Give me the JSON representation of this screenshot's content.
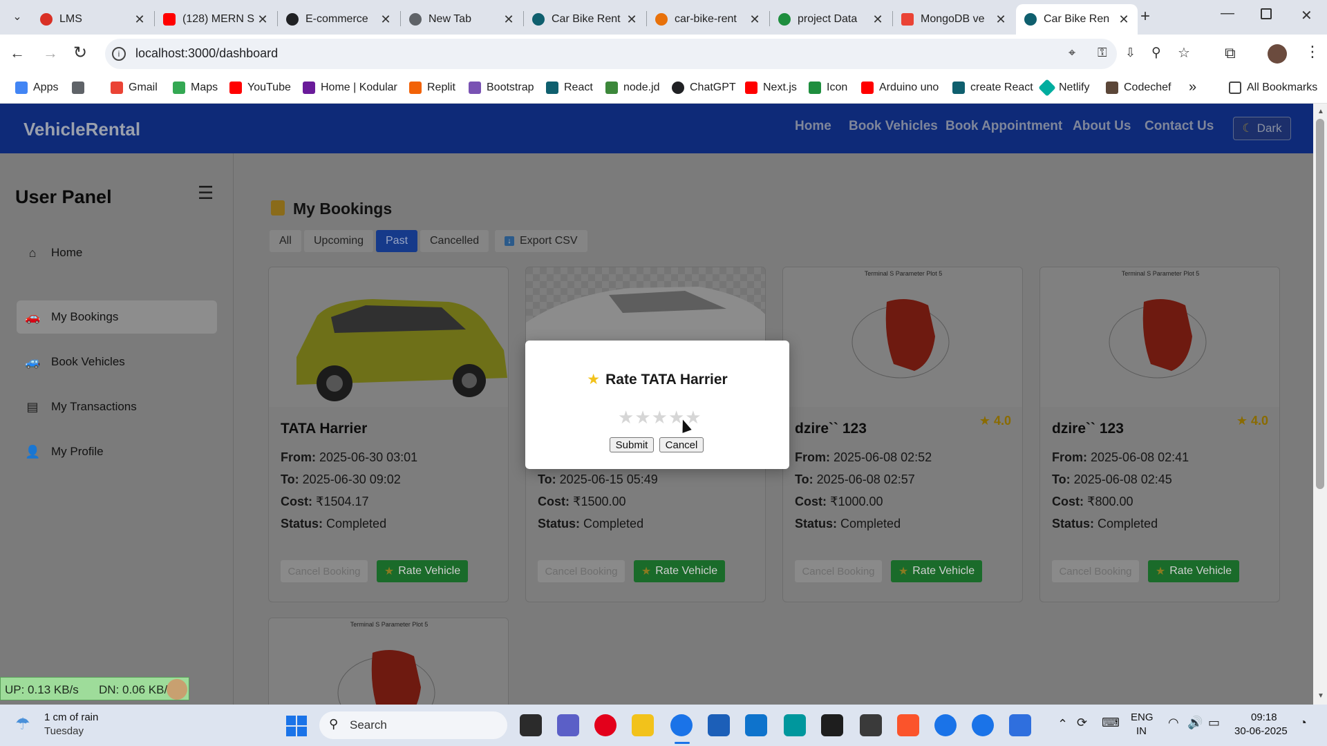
{
  "browser": {
    "tabs": [
      {
        "title": "LMS",
        "favicon_color": "#d93025"
      },
      {
        "title": "(128) MERN S",
        "favicon_color": "#ff0000"
      },
      {
        "title": "E-commerce",
        "favicon_color": "#202124"
      },
      {
        "title": "New Tab",
        "favicon_color": "#5f6368"
      },
      {
        "title": "Car Bike Rent",
        "favicon_color": "#0f5f6e"
      },
      {
        "title": "car-bike-rent",
        "favicon_color": "#e8710a"
      },
      {
        "title": "project Data",
        "favicon_color": "#1e8e3e"
      },
      {
        "title": "MongoDB ve",
        "favicon_color": "#ea4335"
      },
      {
        "title": "Car Bike Ren",
        "favicon_color": "#0f5f6e"
      }
    ],
    "url": "localhost:3000/dashboard",
    "bookmarks": [
      {
        "label": "Apps",
        "color": "#4285f4"
      },
      {
        "label": "",
        "color": "#5f6368"
      },
      {
        "label": "Gmail",
        "color": "#ea4335"
      },
      {
        "label": "Maps",
        "color": "#34a853"
      },
      {
        "label": "YouTube",
        "color": "#ff0000"
      },
      {
        "label": "Home | Kodular",
        "color": "#6a1b9a"
      },
      {
        "label": "Replit",
        "color": "#f26207"
      },
      {
        "label": "Bootstrap",
        "color": "#7952b3"
      },
      {
        "label": "React",
        "color": "#0f5f6e"
      },
      {
        "label": "node.jd",
        "color": "#3c873a"
      },
      {
        "label": "ChatGPT",
        "color": "#202124"
      },
      {
        "label": "Next.js",
        "color": "#ff0000"
      },
      {
        "label": "Icon",
        "color": "#1e8e3e"
      },
      {
        "label": "Arduino uno",
        "color": "#ff0000"
      },
      {
        "label": "create React",
        "color": "#0f5f6e"
      },
      {
        "label": "Netlify",
        "color": "#00ad9f"
      },
      {
        "label": "Codechef",
        "color": "#5b4638"
      }
    ],
    "more_bookmarks": "»",
    "all_bookmarks": "All Bookmarks"
  },
  "navbar": {
    "brand": "VehicleRental",
    "links": [
      "Home",
      "Book Vehicles",
      "Book Appointment",
      "About Us",
      "Contact Us"
    ],
    "theme_button": "Dark"
  },
  "sidebar": {
    "title": "User Panel",
    "items": [
      {
        "label": "Home",
        "icon": "home-icon"
      },
      {
        "label": "My Bookings",
        "icon": "car-icon"
      },
      {
        "label": "Book Vehicles",
        "icon": "car-icon"
      },
      {
        "label": "My Transactions",
        "icon": "wallet-icon"
      },
      {
        "label": "My Profile",
        "icon": "user-icon"
      }
    ]
  },
  "main": {
    "heading": "My Bookings",
    "filters": [
      "All",
      "Upcoming",
      "Past",
      "Cancelled"
    ],
    "active_filter": "Past",
    "export_label": "Export CSV",
    "cards": [
      {
        "title": "TATA Harrier",
        "from": "2025-06-30 03:01",
        "to": "2025-06-30 09:02",
        "cost": "₹1504.17",
        "status": "Completed",
        "rating": "",
        "image": "yellow-suv"
      },
      {
        "title": "",
        "from": "",
        "to": "2025-06-15 05:49",
        "cost": "₹1500.00",
        "status": "Completed",
        "rating": "",
        "image": "white-sedan"
      },
      {
        "title": "dzire`` 123",
        "from": "2025-06-08 02:52",
        "to": "2025-06-08 02:57",
        "cost": "₹1000.00",
        "status": "Completed",
        "rating": "4.0",
        "image": "plot"
      },
      {
        "title": "dzire`` 123",
        "from": "2025-06-08 02:41",
        "to": "2025-06-08 02:45",
        "cost": "₹800.00",
        "status": "Completed",
        "rating": "4.0",
        "image": "plot"
      }
    ],
    "labels": {
      "from": "From:",
      "to": "To:",
      "cost": "Cost:",
      "status": "Status:"
    },
    "cancel_label": "Cancel Booking",
    "rate_label": "Rate Vehicle",
    "plot_caption": "Terminal S Parameter Plot 5"
  },
  "modal": {
    "title": "Rate TATA Harrier",
    "stars": 5,
    "selected": 0,
    "submit": "Submit",
    "cancel": "Cancel"
  },
  "netmeter": {
    "up": "UP: 0.13 KB/s",
    "down": "DN: 0.06 KB/s"
  },
  "taskbar": {
    "weather_line1": "1 cm of rain",
    "weather_line2": "Tuesday",
    "search_placeholder": "Search",
    "lang1": "ENG",
    "lang2": "IN",
    "time": "09:18",
    "date": "30-06-2025"
  }
}
